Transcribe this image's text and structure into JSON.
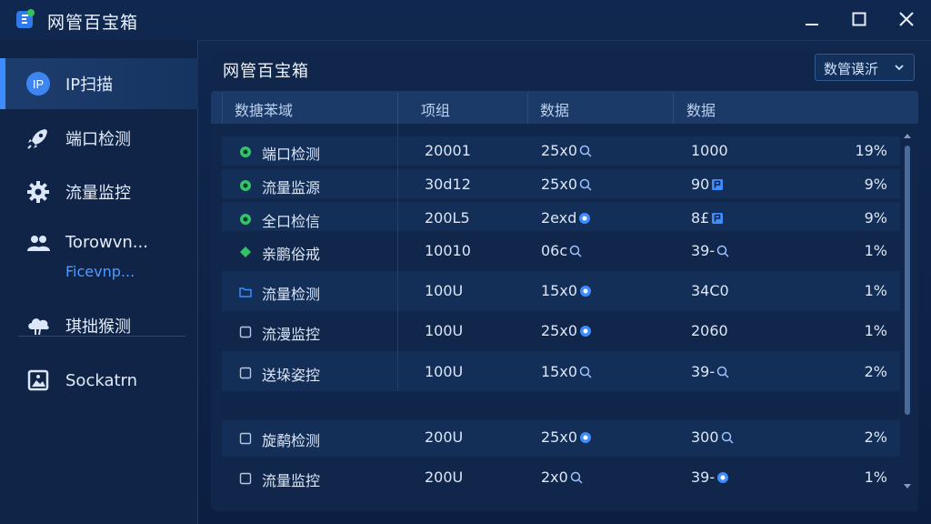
{
  "app": {
    "title": "网管百宝箱"
  },
  "sidebar": {
    "items": [
      {
        "label": "IP扫描",
        "icon": "ip-icon"
      },
      {
        "label": "端口检测",
        "icon": "rocket-icon"
      },
      {
        "label": "流量监控",
        "icon": "gear-icon"
      },
      {
        "label": "Torowvn...",
        "sub": "Ficevnp...",
        "icon": "users-icon"
      },
      {
        "label": "琪拙猴测",
        "icon": "cloud-icon"
      },
      {
        "label": "Sockatrn",
        "icon": "image-icon"
      }
    ]
  },
  "main": {
    "title": "网管百宝箱",
    "dropdown": {
      "selected": "数管谟沂"
    },
    "columns": [
      "数搪苯域",
      "项组",
      "数据",
      "数据"
    ],
    "rows": [
      {
        "name": "端口检测",
        "status": "green-dot",
        "c2": "20001",
        "c3": "25x0",
        "c3_icon": "search-icon",
        "c4": "1000",
        "c4_icon": "",
        "pct": "19%"
      },
      {
        "name": "流量监源",
        "status": "green-dot",
        "c2": "30d12",
        "c3": "25x0",
        "c3_icon": "search-icon",
        "c4": "90",
        "c4_icon": "flag-icon",
        "pct": "9%"
      },
      {
        "name": "全口检信",
        "status": "green-dot",
        "c2": "200L5",
        "c3": "2exd",
        "c3_icon": "target-icon",
        "c4": "8£",
        "c4_icon": "flag-icon",
        "pct": "9%"
      },
      {
        "name": "亲鹏俗戒",
        "status": "green-diamond",
        "c2": "10010",
        "c3": "06c",
        "c3_icon": "search-icon",
        "c4": "39-",
        "c4_icon": "search-icon",
        "pct": "1%"
      },
      {
        "name": "流量检测",
        "status": "folder",
        "c2": "100U",
        "c3": "15x0",
        "c3_icon": "target-icon",
        "c4": "34C0",
        "c4_icon": "",
        "pct": "1%"
      },
      {
        "name": "流漫监控",
        "status": "checkbox",
        "c2": "100U",
        "c3": "25x0",
        "c3_icon": "target-icon",
        "c4": "2060",
        "c4_icon": "",
        "pct": "1%"
      },
      {
        "name": "送垛姿控",
        "status": "checkbox",
        "c2": "100U",
        "c3": "15x0",
        "c3_icon": "search-icon",
        "c4": "39-",
        "c4_icon": "search-icon",
        "pct": "2%"
      },
      {
        "name": "旋鹬检测",
        "status": "checkbox",
        "c2": "200U",
        "c3": "25x0",
        "c3_icon": "target-icon",
        "c4": "300",
        "c4_icon": "search-icon",
        "pct": "2%"
      },
      {
        "name": "流量监控",
        "status": "checkbox",
        "c2": "200U",
        "c3": "2x0",
        "c3_icon": "search-icon",
        "c4": "39-",
        "c4_icon": "target-icon",
        "pct": "1%"
      }
    ]
  },
  "colors": {
    "accent": "#3f8cff",
    "green": "#33c46b",
    "background": "#0d2144"
  }
}
